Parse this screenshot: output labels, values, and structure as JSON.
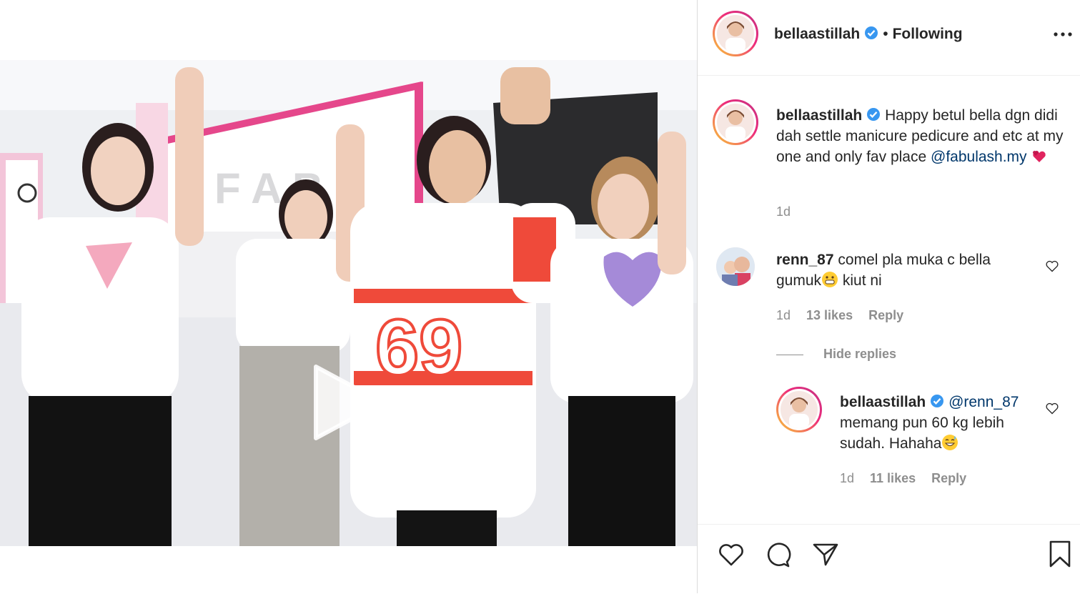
{
  "post": {
    "username": "bellaastillah",
    "separator": "•",
    "follow_status": "Following",
    "caption_text": "Happy betul bella dgn didi dah settle manicure pedicure and etc at my one and only fav place",
    "caption_mention": "@fabulash.my",
    "time": "1d"
  },
  "comments": [
    {
      "username": "renn_87",
      "text_before": "comel pla muka c bella gumuk",
      "text_after": " kiut ni",
      "time": "1d",
      "likes": "13 likes",
      "reply": "Reply"
    }
  ],
  "hide_replies": "Hide replies",
  "replies": [
    {
      "username": "bellaastillah",
      "mention": "@renn_87",
      "text": "memang pun 60 kg lebih sudah. Hahaha",
      "time": "1d",
      "likes": "11 likes",
      "reply": "Reply"
    }
  ],
  "icons": {
    "verified": "verified-badge-icon",
    "more": "more-options-icon",
    "like": "heart-icon",
    "comment": "comment-icon",
    "share": "share-icon",
    "save": "bookmark-icon",
    "play": "play-icon"
  },
  "colors": {
    "accent_link": "#00376b",
    "verified_blue": "#3897f0",
    "muted_text": "#8e8e8e",
    "heart_red": "#ed4956"
  }
}
